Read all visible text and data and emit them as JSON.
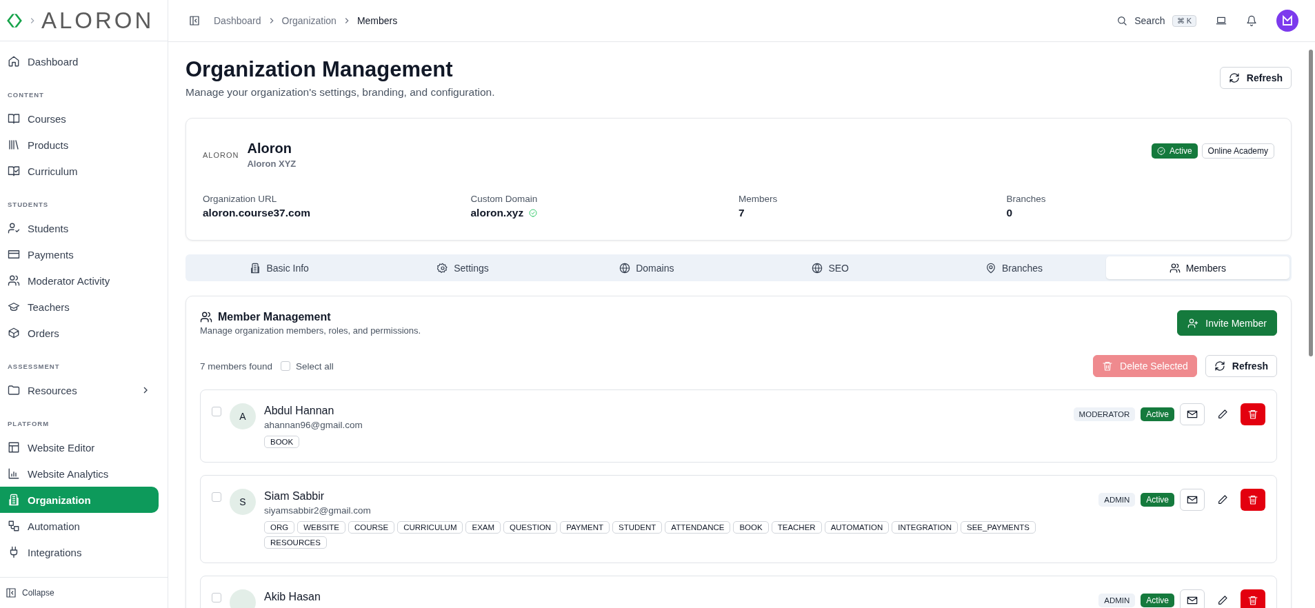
{
  "brand": {
    "logo": "ALORON"
  },
  "sidebar": {
    "sections": [
      {
        "items": [
          {
            "label": "Dashboard",
            "selected": false,
            "has_submenu": false
          }
        ]
      },
      {
        "heading": "CONTENT",
        "items": [
          {
            "label": "Courses",
            "selected": false,
            "has_submenu": false
          },
          {
            "label": "Products",
            "selected": false,
            "has_submenu": false
          },
          {
            "label": "Curriculum",
            "selected": false,
            "has_submenu": false
          }
        ]
      },
      {
        "heading": "STUDENTS",
        "items": [
          {
            "label": "Students",
            "selected": false,
            "has_submenu": false
          },
          {
            "label": "Payments",
            "selected": false,
            "has_submenu": false
          },
          {
            "label": "Moderator Activity",
            "selected": false,
            "has_submenu": false
          },
          {
            "label": "Teachers",
            "selected": false,
            "has_submenu": false
          },
          {
            "label": "Orders",
            "selected": false,
            "has_submenu": false
          }
        ]
      },
      {
        "heading": "ASSESSMENT",
        "items": [
          {
            "label": "Resources",
            "selected": false,
            "has_submenu": true
          }
        ]
      },
      {
        "heading": "PLATFORM",
        "items": [
          {
            "label": "Website Editor",
            "selected": false,
            "has_submenu": false
          },
          {
            "label": "Website Analytics",
            "selected": false,
            "has_submenu": false
          },
          {
            "label": "Organization",
            "selected": true,
            "has_submenu": false
          },
          {
            "label": "Automation",
            "selected": false,
            "has_submenu": false
          },
          {
            "label": "Integrations",
            "selected": false,
            "has_submenu": false
          }
        ]
      }
    ],
    "collapse": "Collapse"
  },
  "breadcrumbs": [
    "Dashboard",
    "Organization",
    "Members"
  ],
  "search": {
    "label": "Search",
    "shortcut": "⌘ K"
  },
  "page": {
    "title": "Organization Management",
    "subtitle": "Manage your organization's settings, branding, and configuration.",
    "refresh": "Refresh"
  },
  "organization": {
    "logo": "ALORON",
    "name": "Aloron",
    "subtitle": "Aloron XYZ",
    "status": "Active",
    "type": "Online Academy",
    "fields": [
      {
        "label": "Organization URL",
        "value": "aloron.course37.com",
        "verified": false
      },
      {
        "label": "Custom Domain",
        "value": "aloron.xyz",
        "verified": true
      },
      {
        "label": "Members",
        "value": "7",
        "verified": false
      },
      {
        "label": "Branches",
        "value": "0",
        "verified": false
      }
    ]
  },
  "tabs": [
    {
      "label": "Basic Info",
      "selected": false
    },
    {
      "label": "Settings",
      "selected": false
    },
    {
      "label": "Domains",
      "selected": false
    },
    {
      "label": "SEO",
      "selected": false
    },
    {
      "label": "Branches",
      "selected": false
    },
    {
      "label": "Members",
      "selected": true
    }
  ],
  "member_management": {
    "title": "Member Management",
    "subtitle": "Manage organization members, roles, and permissions.",
    "invite": "Invite Member",
    "count": "7 members found",
    "select_all": {
      "label": "Select all",
      "checked": false
    },
    "delete_selected": {
      "label": "Delete Selected",
      "disabled": true
    },
    "refresh": "Refresh",
    "members": [
      {
        "initial": "A",
        "name": "Abdul Hannan",
        "email": "ahannan96@gmail.com",
        "role": "MODERATOR",
        "status": "Active",
        "selected": false,
        "permissions": [
          "BOOK"
        ]
      },
      {
        "initial": "S",
        "name": "Siam Sabbir",
        "email": "siyamsabbir2@gmail.com",
        "role": "ADMIN",
        "status": "Active",
        "selected": false,
        "permissions": [
          "ORG",
          "WEBSITE",
          "COURSE",
          "CURRICULUM",
          "EXAM",
          "QUESTION",
          "PAYMENT",
          "STUDENT",
          "ATTENDANCE",
          "BOOK",
          "TEACHER",
          "AUTOMATION",
          "INTEGRATION",
          "SEE_PAYMENTS",
          "RESOURCES"
        ]
      },
      {
        "name": "Akib Hasan",
        "role": "ADMIN",
        "status": "Active",
        "selected": false
      }
    ]
  }
}
